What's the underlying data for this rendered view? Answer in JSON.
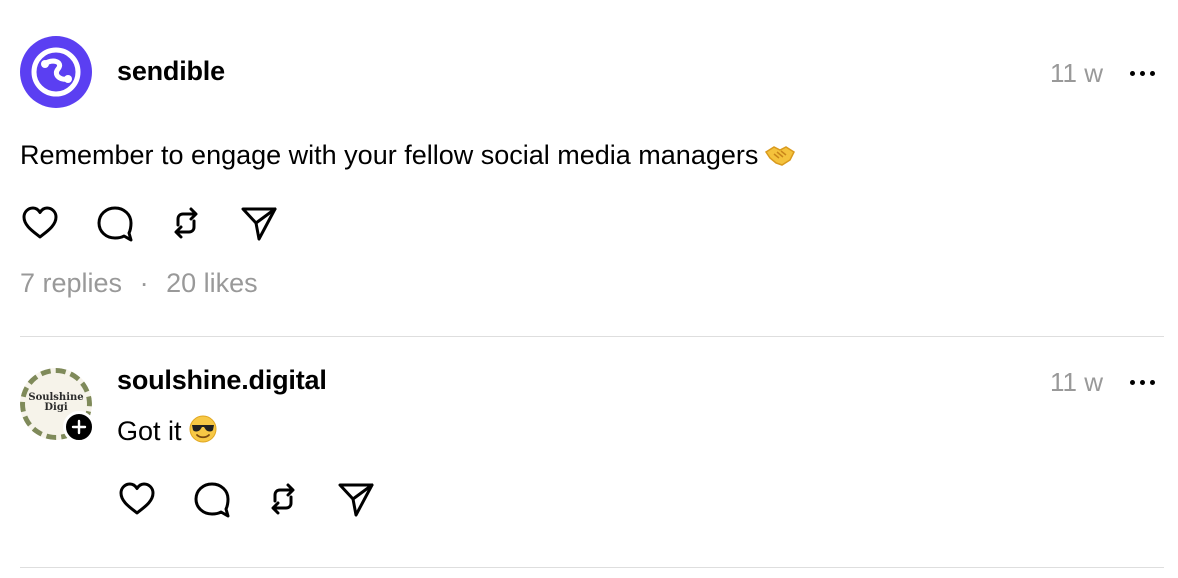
{
  "posts": [
    {
      "username": "sendible",
      "timestamp": "11 w",
      "text": "Remember to engage with your fellow social media managers",
      "emoji": "handshake-emoji",
      "stats": {
        "replies": "7 replies",
        "separator": "·",
        "likes": "20 likes"
      },
      "avatar": {
        "type": "logo",
        "color": "#5b3ff2"
      }
    },
    {
      "username": "soulshine.digital",
      "timestamp": "11 w",
      "text": "Got it",
      "emoji": "sunglasses-emoji",
      "avatar": {
        "type": "image",
        "text_line1": "Soulshine",
        "text_line2": "Digi"
      }
    }
  ],
  "icons": {
    "like": "heart-icon",
    "reply": "speech-bubble-icon",
    "repost": "repost-icon",
    "share": "send-icon",
    "more": "more-horizontal-icon",
    "follow": "plus-icon"
  },
  "colors": {
    "text": "#000000",
    "muted": "#999999",
    "divider": "#dedede",
    "brand": "#5b3ff2"
  }
}
